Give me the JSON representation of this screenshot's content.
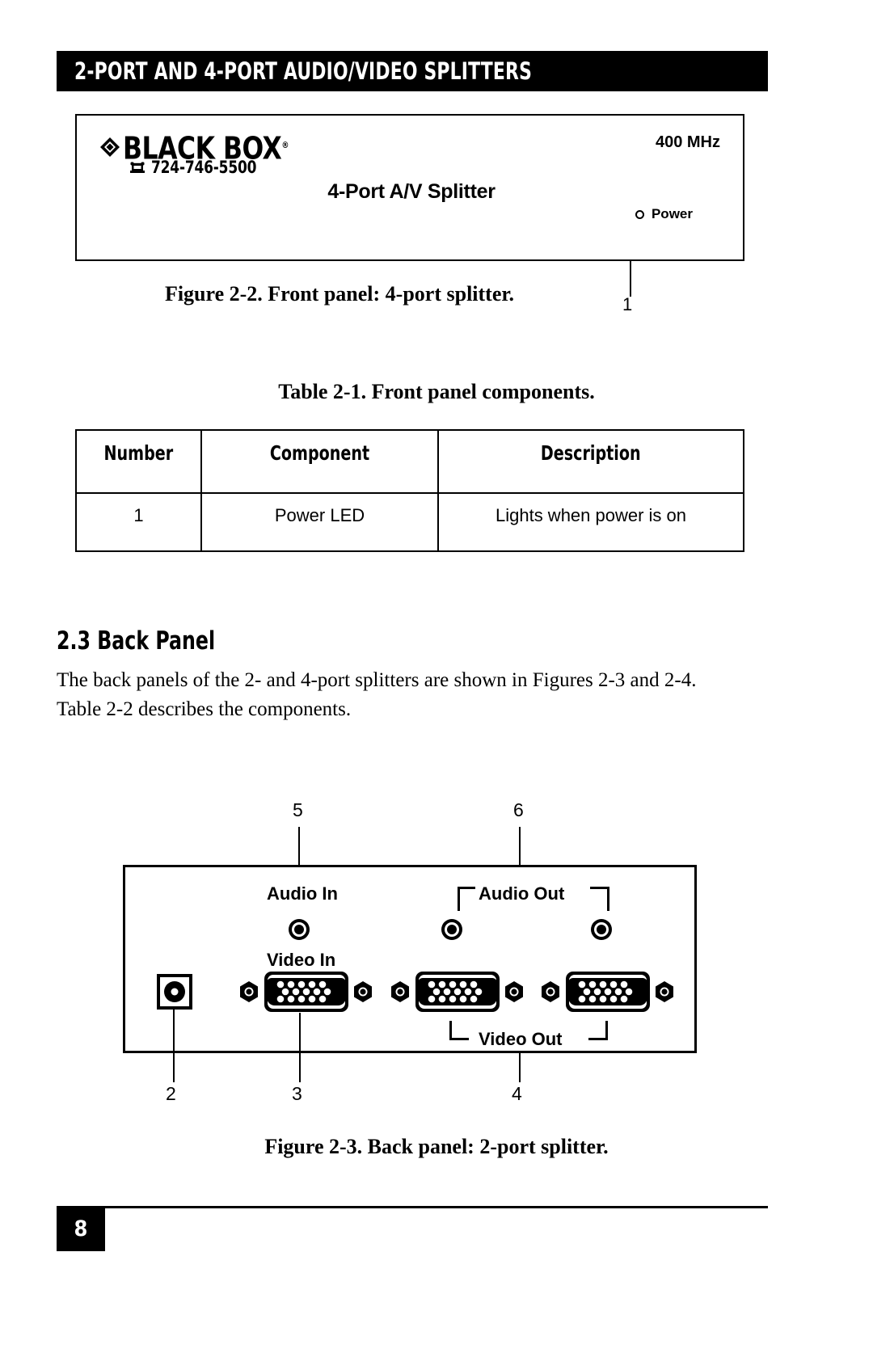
{
  "header": {
    "title": "2-PORT AND 4-PORT AUDIO/VIDEO SPLITTERS"
  },
  "front_panel": {
    "brand": "BLACK BOX",
    "registered_mark": "®",
    "phone": "724-746-5500",
    "phone_icon": "telephone-icon",
    "diamond_icon": "black-box-diamond-logo",
    "model_label": "4-Port A/V Splitter",
    "bandwidth": "400 MHz",
    "led_label": "Power",
    "led_icon": "power-led-indicator",
    "callout": "1"
  },
  "figure_2_2": {
    "caption": "Figure 2-2. Front panel: 4-port splitter."
  },
  "table_2_1": {
    "caption": "Table 2-1. Front panel components.",
    "columns": [
      "Number",
      "Component",
      "Description"
    ],
    "rows": [
      [
        "1",
        "Power LED",
        "Lights when power is on"
      ]
    ]
  },
  "section": {
    "heading": "2.3 Back Panel",
    "paragraph": "The back panels of the 2- and 4-port splitters are shown in Figures 2-3 and 2-4. Table 2-2 describes the components."
  },
  "back_panel": {
    "callouts": {
      "top_left": "5",
      "top_right": "6",
      "bottom_power": "2",
      "bottom_video_in": "3",
      "bottom_video_out": "4"
    },
    "labels": {
      "audio_in": "Audio In",
      "audio_out": "Audio Out",
      "video_in": "Video In",
      "video_out": "Video Out"
    },
    "connectors": [
      {
        "name": "power-jack",
        "type": "dc-power"
      },
      {
        "name": "video-in-vga",
        "type": "hd15"
      },
      {
        "name": "video-out-vga-1",
        "type": "hd15"
      },
      {
        "name": "video-out-vga-2",
        "type": "hd15"
      },
      {
        "name": "audio-in-jack",
        "type": "3.5mm"
      },
      {
        "name": "audio-out-jack-1",
        "type": "3.5mm"
      },
      {
        "name": "audio-out-jack-2",
        "type": "3.5mm"
      }
    ]
  },
  "figure_2_3": {
    "caption": "Figure 2-3. Back panel: 2-port splitter."
  },
  "footer": {
    "page_number": "8"
  },
  "colors": {
    "ink": "#000000",
    "paper": "#ffffff"
  }
}
